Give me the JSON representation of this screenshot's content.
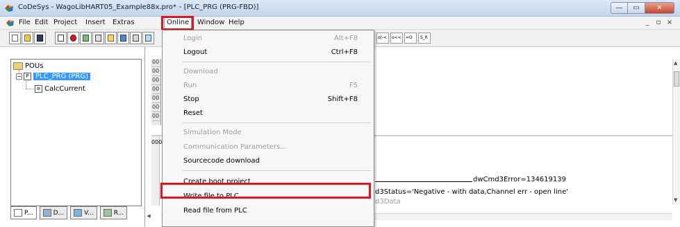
{
  "window": {
    "title": "CoDeSys - WagoLibHART05_Example88x.pro*",
    "subtitle": "- [PLC_PRG (PRG-FBD)]",
    "min_label": "—",
    "max_label": "▭",
    "close_label": "✕"
  },
  "menu": {
    "items": [
      "File",
      "Edit",
      "Project",
      "Insert",
      "Extras",
      "Online",
      "Window",
      "Help"
    ],
    "mdi_min": "_",
    "mdi_max": "▫",
    "mdi_close": "×"
  },
  "toolbar": {
    "right_buttons": [
      "o|-<",
      "o<<",
      "=O",
      "S_R"
    ]
  },
  "dropdown": {
    "items": [
      {
        "label": "Login",
        "shortcut": "Alt+F8",
        "enabled": false
      },
      {
        "label": "Logout",
        "shortcut": "Ctrl+F8",
        "enabled": true
      },
      {
        "label": "Download",
        "shortcut": "",
        "enabled": false
      },
      {
        "label": "Run",
        "shortcut": "F5",
        "enabled": false
      },
      {
        "label": "Stop",
        "shortcut": "Shift+F8",
        "enabled": true
      },
      {
        "label": "Reset",
        "shortcut": "",
        "enabled": true
      },
      {
        "label": "Simulation Mode",
        "shortcut": "",
        "enabled": false
      },
      {
        "label": "Communication Parameters...",
        "shortcut": "",
        "enabled": false
      },
      {
        "label": "Sourcecode download",
        "shortcut": "",
        "enabled": true
      },
      {
        "label": "Create boot project",
        "shortcut": "",
        "enabled": true
      },
      {
        "label": "Write file to PLC",
        "shortcut": "",
        "enabled": true
      },
      {
        "label": "Read file from PLC",
        "shortcut": "",
        "enabled": true
      }
    ]
  },
  "tree": {
    "root": "POUs",
    "expander": "−",
    "prg_icon": "P",
    "child_icon": "≡",
    "selected": "PLC_PRG (PRG)",
    "child": "CalcCurrent"
  },
  "tabs": [
    "P...",
    "D...",
    "V...",
    "R..."
  ],
  "editor": {
    "gutter": [
      "00",
      "00",
      "00",
      "00",
      "00",
      "00",
      "00"
    ],
    "body_gutter": "000",
    "error_text": "dwCmd3Error=134619139",
    "status_text": "d3Status='Negative - with data,Channel err - open line'",
    "data_text": "d3Data"
  },
  "colors": {
    "highlight_red": "#e0141e",
    "selection_blue": "#3399ff"
  }
}
